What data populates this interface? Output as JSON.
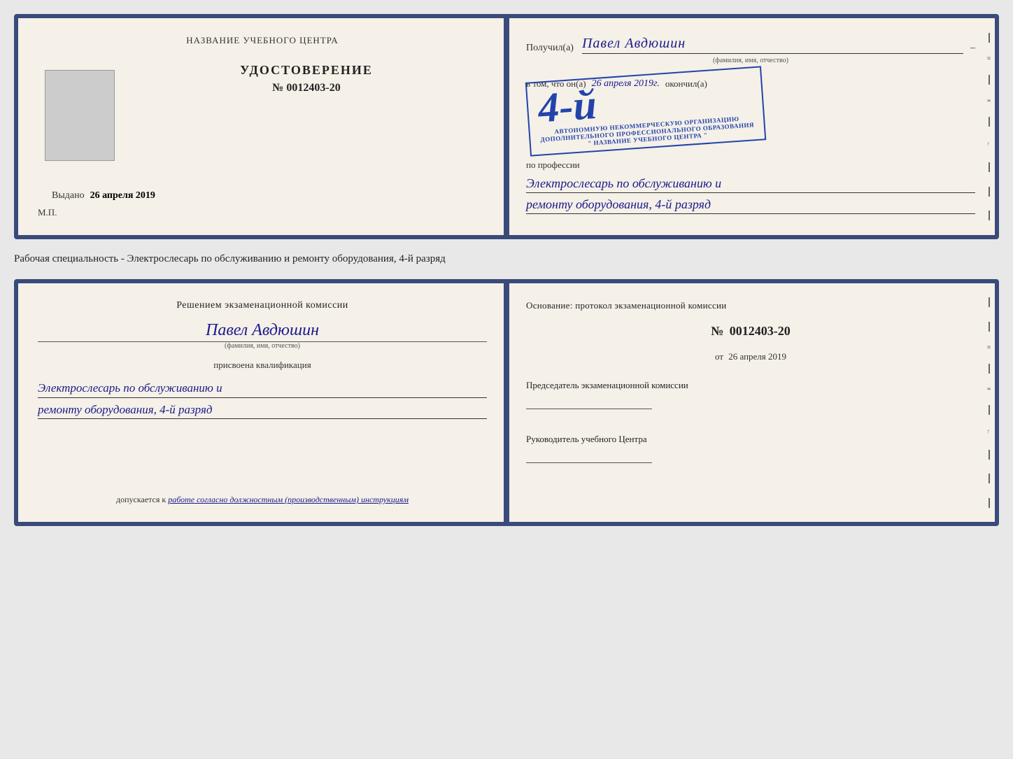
{
  "top_doc": {
    "left": {
      "header": "НАЗВАНИЕ УЧЕБНОГО ЦЕНТРА",
      "title": "УДОСТОВЕРЕНИЕ",
      "number_label": "№",
      "number_value": "0012403-20",
      "issued_label": "Выдано",
      "issued_date": "26 апреля 2019",
      "mp": "М.П."
    },
    "right": {
      "recipient_label": "Получил(а)",
      "recipient_name": "Павел Авдюшин",
      "fio_hint": "(фамилия, имя, отчество)",
      "dash": "–",
      "in_that": "в том, что он(а)",
      "date_handwritten": "26 апреля 2019г.",
      "finished_label": "окончил(а)",
      "stamp_grade": "4-й",
      "stamp_line1": "АВТОНОМНУЮ НЕКОММЕРЧЕСКУЮ ОРГАНИЗАЦИЮ",
      "stamp_line2": "ДОПОЛНИТЕЛЬНОГО ПРОФЕССИОНАЛЬНОГО ОБРАЗОВАНИЯ",
      "stamp_center": "\" НАЗВАНИЕ УЧЕБНОГО ЦЕНТРА \"",
      "profession_label": "по профессии",
      "profession_line1": "Электрослесарь по обслуживанию и",
      "profession_line2": "ремонту оборудования, 4-й разряд"
    }
  },
  "between_text": "Рабочая специальность - Электрослесарь по обслуживанию и ремонту оборудования, 4-й разряд",
  "bottom_doc": {
    "left": {
      "decision_text": "Решением экзаменационной комиссии",
      "person_name": "Павел Авдюшин",
      "fio_hint": "(фамилия, имя, отчество)",
      "assigned_label": "присвоена квалификация",
      "qualification_line1": "Электрослесарь по обслуживанию и",
      "qualification_line2": "ремонту оборудования, 4-й разряд",
      "admission_prefix": "допускается к",
      "admission_text": "работе согласно должностным (производственным) инструкциям"
    },
    "right": {
      "basis_text": "Основание: протокол экзаменационной комиссии",
      "protocol_label": "№",
      "protocol_number": "0012403-20",
      "date_prefix": "от",
      "date_value": "26 апреля 2019",
      "committee_chairman_label": "Председатель экзаменационной комиссии",
      "center_head_label": "Руководитель учебного Центра"
    }
  },
  "side_chars": {
    "and": "и",
    "ya": "я",
    "arrow": "←"
  }
}
